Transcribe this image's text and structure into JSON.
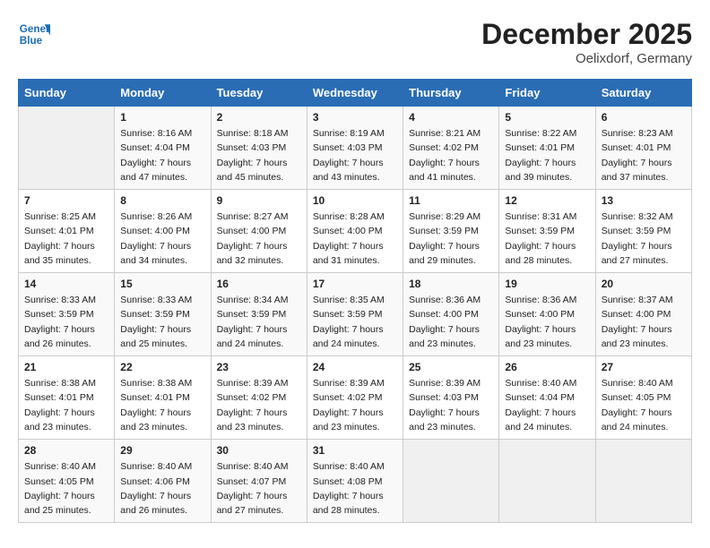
{
  "logo": {
    "line1": "General",
    "line2": "Blue"
  },
  "title": "December 2025",
  "location": "Oelixdorf, Germany",
  "days_of_week": [
    "Sunday",
    "Monday",
    "Tuesday",
    "Wednesday",
    "Thursday",
    "Friday",
    "Saturday"
  ],
  "weeks": [
    [
      {
        "day": "",
        "sunrise": "",
        "sunset": "",
        "daylight": ""
      },
      {
        "day": "1",
        "sunrise": "Sunrise: 8:16 AM",
        "sunset": "Sunset: 4:04 PM",
        "daylight": "Daylight: 7 hours and 47 minutes."
      },
      {
        "day": "2",
        "sunrise": "Sunrise: 8:18 AM",
        "sunset": "Sunset: 4:03 PM",
        "daylight": "Daylight: 7 hours and 45 minutes."
      },
      {
        "day": "3",
        "sunrise": "Sunrise: 8:19 AM",
        "sunset": "Sunset: 4:03 PM",
        "daylight": "Daylight: 7 hours and 43 minutes."
      },
      {
        "day": "4",
        "sunrise": "Sunrise: 8:21 AM",
        "sunset": "Sunset: 4:02 PM",
        "daylight": "Daylight: 7 hours and 41 minutes."
      },
      {
        "day": "5",
        "sunrise": "Sunrise: 8:22 AM",
        "sunset": "Sunset: 4:01 PM",
        "daylight": "Daylight: 7 hours and 39 minutes."
      },
      {
        "day": "6",
        "sunrise": "Sunrise: 8:23 AM",
        "sunset": "Sunset: 4:01 PM",
        "daylight": "Daylight: 7 hours and 37 minutes."
      }
    ],
    [
      {
        "day": "7",
        "sunrise": "Sunrise: 8:25 AM",
        "sunset": "Sunset: 4:01 PM",
        "daylight": "Daylight: 7 hours and 35 minutes."
      },
      {
        "day": "8",
        "sunrise": "Sunrise: 8:26 AM",
        "sunset": "Sunset: 4:00 PM",
        "daylight": "Daylight: 7 hours and 34 minutes."
      },
      {
        "day": "9",
        "sunrise": "Sunrise: 8:27 AM",
        "sunset": "Sunset: 4:00 PM",
        "daylight": "Daylight: 7 hours and 32 minutes."
      },
      {
        "day": "10",
        "sunrise": "Sunrise: 8:28 AM",
        "sunset": "Sunset: 4:00 PM",
        "daylight": "Daylight: 7 hours and 31 minutes."
      },
      {
        "day": "11",
        "sunrise": "Sunrise: 8:29 AM",
        "sunset": "Sunset: 3:59 PM",
        "daylight": "Daylight: 7 hours and 29 minutes."
      },
      {
        "day": "12",
        "sunrise": "Sunrise: 8:31 AM",
        "sunset": "Sunset: 3:59 PM",
        "daylight": "Daylight: 7 hours and 28 minutes."
      },
      {
        "day": "13",
        "sunrise": "Sunrise: 8:32 AM",
        "sunset": "Sunset: 3:59 PM",
        "daylight": "Daylight: 7 hours and 27 minutes."
      }
    ],
    [
      {
        "day": "14",
        "sunrise": "Sunrise: 8:33 AM",
        "sunset": "Sunset: 3:59 PM",
        "daylight": "Daylight: 7 hours and 26 minutes."
      },
      {
        "day": "15",
        "sunrise": "Sunrise: 8:33 AM",
        "sunset": "Sunset: 3:59 PM",
        "daylight": "Daylight: 7 hours and 25 minutes."
      },
      {
        "day": "16",
        "sunrise": "Sunrise: 8:34 AM",
        "sunset": "Sunset: 3:59 PM",
        "daylight": "Daylight: 7 hours and 24 minutes."
      },
      {
        "day": "17",
        "sunrise": "Sunrise: 8:35 AM",
        "sunset": "Sunset: 3:59 PM",
        "daylight": "Daylight: 7 hours and 24 minutes."
      },
      {
        "day": "18",
        "sunrise": "Sunrise: 8:36 AM",
        "sunset": "Sunset: 4:00 PM",
        "daylight": "Daylight: 7 hours and 23 minutes."
      },
      {
        "day": "19",
        "sunrise": "Sunrise: 8:36 AM",
        "sunset": "Sunset: 4:00 PM",
        "daylight": "Daylight: 7 hours and 23 minutes."
      },
      {
        "day": "20",
        "sunrise": "Sunrise: 8:37 AM",
        "sunset": "Sunset: 4:00 PM",
        "daylight": "Daylight: 7 hours and 23 minutes."
      }
    ],
    [
      {
        "day": "21",
        "sunrise": "Sunrise: 8:38 AM",
        "sunset": "Sunset: 4:01 PM",
        "daylight": "Daylight: 7 hours and 23 minutes."
      },
      {
        "day": "22",
        "sunrise": "Sunrise: 8:38 AM",
        "sunset": "Sunset: 4:01 PM",
        "daylight": "Daylight: 7 hours and 23 minutes."
      },
      {
        "day": "23",
        "sunrise": "Sunrise: 8:39 AM",
        "sunset": "Sunset: 4:02 PM",
        "daylight": "Daylight: 7 hours and 23 minutes."
      },
      {
        "day": "24",
        "sunrise": "Sunrise: 8:39 AM",
        "sunset": "Sunset: 4:02 PM",
        "daylight": "Daylight: 7 hours and 23 minutes."
      },
      {
        "day": "25",
        "sunrise": "Sunrise: 8:39 AM",
        "sunset": "Sunset: 4:03 PM",
        "daylight": "Daylight: 7 hours and 23 minutes."
      },
      {
        "day": "26",
        "sunrise": "Sunrise: 8:40 AM",
        "sunset": "Sunset: 4:04 PM",
        "daylight": "Daylight: 7 hours and 24 minutes."
      },
      {
        "day": "27",
        "sunrise": "Sunrise: 8:40 AM",
        "sunset": "Sunset: 4:05 PM",
        "daylight": "Daylight: 7 hours and 24 minutes."
      }
    ],
    [
      {
        "day": "28",
        "sunrise": "Sunrise: 8:40 AM",
        "sunset": "Sunset: 4:05 PM",
        "daylight": "Daylight: 7 hours and 25 minutes."
      },
      {
        "day": "29",
        "sunrise": "Sunrise: 8:40 AM",
        "sunset": "Sunset: 4:06 PM",
        "daylight": "Daylight: 7 hours and 26 minutes."
      },
      {
        "day": "30",
        "sunrise": "Sunrise: 8:40 AM",
        "sunset": "Sunset: 4:07 PM",
        "daylight": "Daylight: 7 hours and 27 minutes."
      },
      {
        "day": "31",
        "sunrise": "Sunrise: 8:40 AM",
        "sunset": "Sunset: 4:08 PM",
        "daylight": "Daylight: 7 hours and 28 minutes."
      },
      {
        "day": "",
        "sunrise": "",
        "sunset": "",
        "daylight": ""
      },
      {
        "day": "",
        "sunrise": "",
        "sunset": "",
        "daylight": ""
      },
      {
        "day": "",
        "sunrise": "",
        "sunset": "",
        "daylight": ""
      }
    ]
  ]
}
